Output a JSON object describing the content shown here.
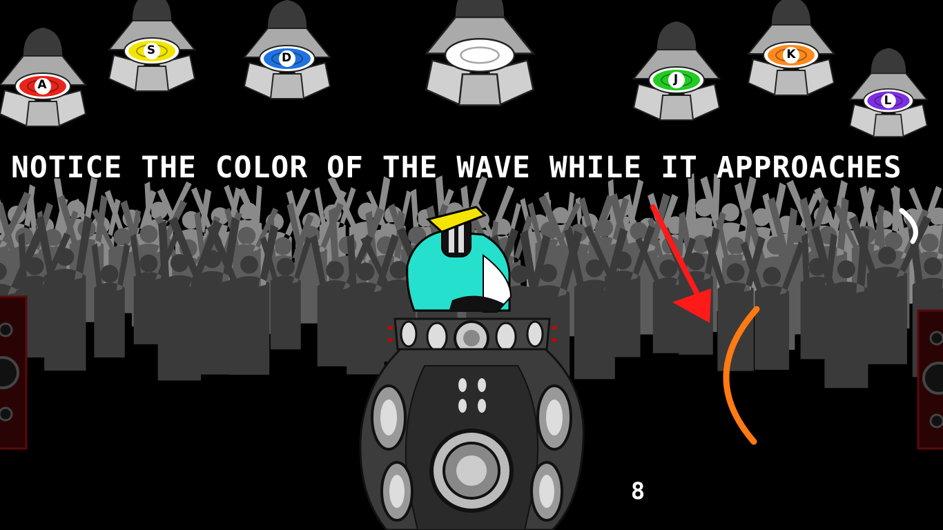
{
  "tutorial_text": "NOTICE THE COLOR OF THE WAVE WHILE IT APPROACHES",
  "score": "8",
  "lamps": [
    {
      "key": "A",
      "color": "#e8241c"
    },
    {
      "key": "S",
      "color": "#f2e600"
    },
    {
      "key": "D",
      "color": "#1e73e0"
    },
    {
      "key": "",
      "color": "#ffffff"
    },
    {
      "key": "J",
      "color": "#22cc22"
    },
    {
      "key": "K",
      "color": "#ff8a1e"
    },
    {
      "key": "L",
      "color": "#7b2fe0"
    }
  ],
  "wave": {
    "color": "#ff7a12"
  },
  "arrow": {
    "color": "#ff1a1a"
  },
  "dj": {
    "jacket_color": "#25e0cc",
    "hat_color": "#f5e400"
  },
  "crowd_colors": [
    "#3a3a3a",
    "#5c5c5c",
    "#8a8a8a"
  ],
  "speaker_cabinet_color": "#4a0a0a"
}
